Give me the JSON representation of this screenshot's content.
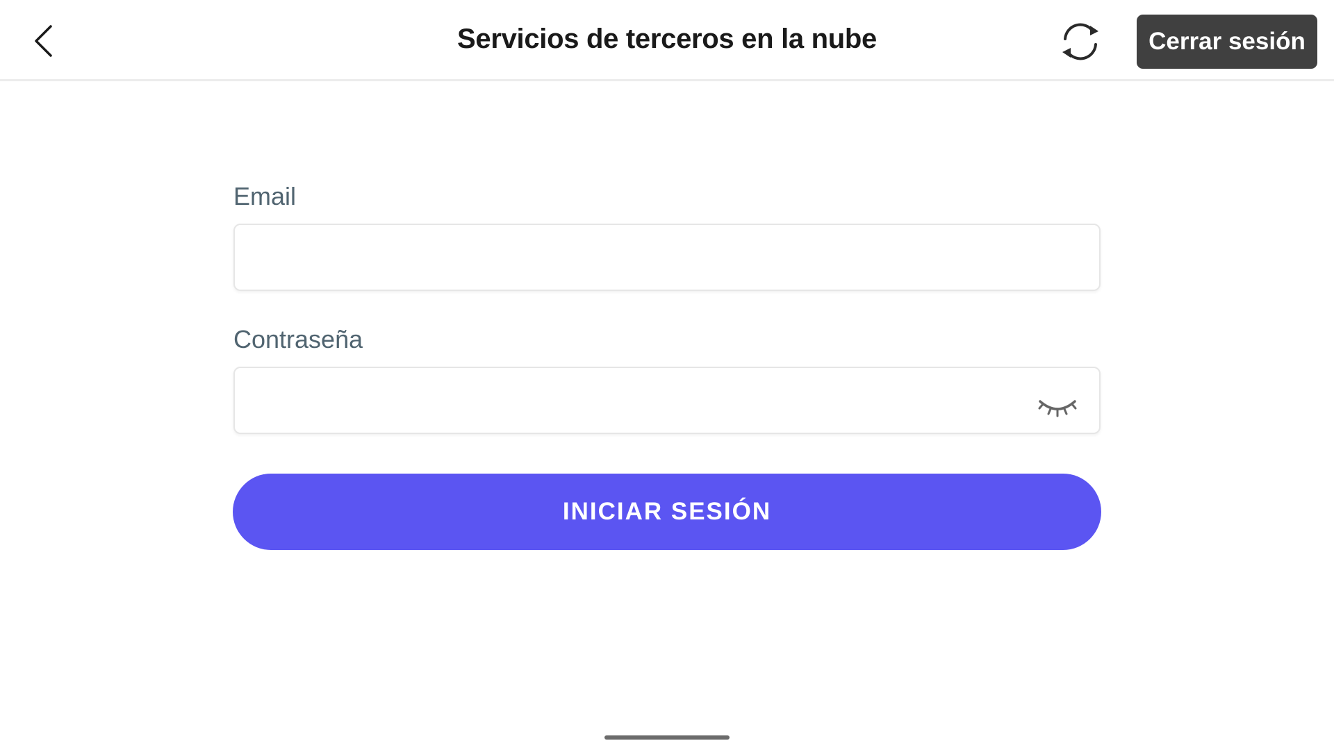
{
  "header": {
    "title": "Servicios de terceros en la nube",
    "back_icon": "chevron-left-icon",
    "sync_icon": "sync-icon",
    "logout_label": "Cerrar sesión"
  },
  "form": {
    "email_label": "Email",
    "email_value": "",
    "email_placeholder": "",
    "password_label": "Contraseña",
    "password_value": "",
    "password_placeholder": "",
    "password_toggle_icon": "eye-closed-icon",
    "login_label": "INICIAR SESIÓN"
  },
  "colors": {
    "primary": "#5b55f2",
    "logout_bg": "#404040",
    "label": "#506470"
  }
}
